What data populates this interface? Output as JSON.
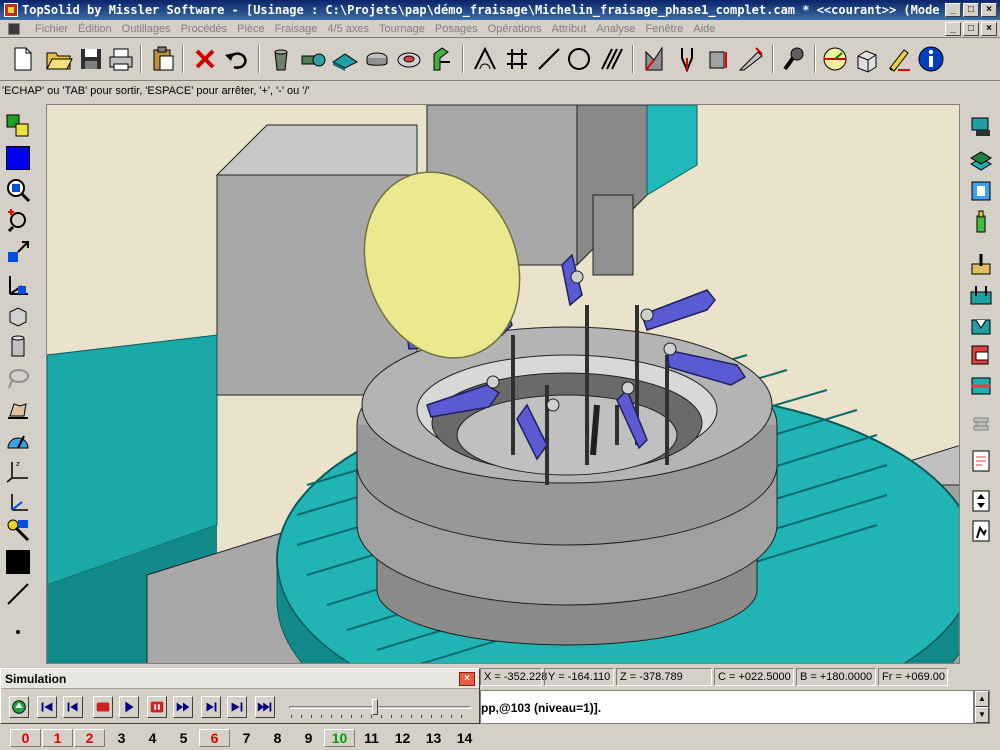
{
  "window": {
    "title": "TopSolid by Missler Software - [Usinage : C:\\Projets\\pap\\démo_fraisage\\Michelin_fraisage_phase1_complet.cam *  <<courant>> (Mode associatif)]",
    "minimize": "_",
    "maximize": "□",
    "close": "×"
  },
  "menu": [
    "Fichier",
    "Édition",
    "Outillages",
    "Procédés",
    "Pièce",
    "Fraisage",
    "4/5 axes",
    "Tournage",
    "Posages",
    "Opérations",
    "Attribut",
    "Analyse",
    "Fenêtre",
    "Aide"
  ],
  "prompt": "'ECHAP' ou 'TAB' pour sortir, 'ESPACE' pour arrêter, '+', '-' ou '/'",
  "toolbar_icons": [
    "new-document-icon",
    "open-folder-icon",
    "save-icon",
    "print-icon",
    "paste-icon",
    "delete-icon",
    "undo-icon",
    "bin-icon",
    "tool-icon",
    "fixture-icon",
    "part-icon",
    "milling-icon",
    "clamp-icon",
    "angle-icon",
    "grid-icon",
    "line-icon",
    "circle-icon",
    "hatch-icon",
    "chart-icon",
    "fork-icon",
    "dimension-icon",
    "measure-icon",
    "microphone-icon",
    "gauge-icon",
    "box-icon",
    "pen-icon",
    "info-icon"
  ],
  "coords": {
    "x": "X = -352.228",
    "y": "Y = -164.110",
    "z": "Z = -378.789",
    "c": "C = +022.5000",
    "b": "B = +180.0000",
    "fr": "Fr = +069.00"
  },
  "command_output": "pp,@103 (niveau=1)].",
  "simulation": {
    "title": "Simulation",
    "close": "×",
    "position": 0.48
  },
  "layers": [
    {
      "label": "0",
      "color": "red",
      "boxed": true
    },
    {
      "label": "1",
      "color": "red",
      "boxed": true
    },
    {
      "label": "2",
      "color": "red",
      "boxed": true
    },
    {
      "label": "3",
      "color": "black",
      "boxed": false
    },
    {
      "label": "4",
      "color": "black",
      "boxed": false
    },
    {
      "label": "5",
      "color": "black",
      "boxed": false
    },
    {
      "label": "6",
      "color": "red",
      "boxed": true
    },
    {
      "label": "7",
      "color": "black",
      "boxed": false
    },
    {
      "label": "8",
      "color": "black",
      "boxed": false
    },
    {
      "label": "9",
      "color": "black",
      "boxed": false
    },
    {
      "label": "10",
      "color": "green",
      "boxed": true
    },
    {
      "label": "11",
      "color": "black",
      "boxed": false
    },
    {
      "label": "12",
      "color": "black",
      "boxed": false
    },
    {
      "label": "13",
      "color": "black",
      "boxed": false
    },
    {
      "label": "14",
      "color": "black",
      "boxed": false
    }
  ],
  "colors": {
    "title_bar": "#0a246a",
    "background_3d": "#e8e0c8",
    "machine_gray": "#a8a8a8",
    "table_cyan": "#1ab0b0",
    "clamp_blue": "#5050c8",
    "disc_yellow": "#ece890"
  }
}
